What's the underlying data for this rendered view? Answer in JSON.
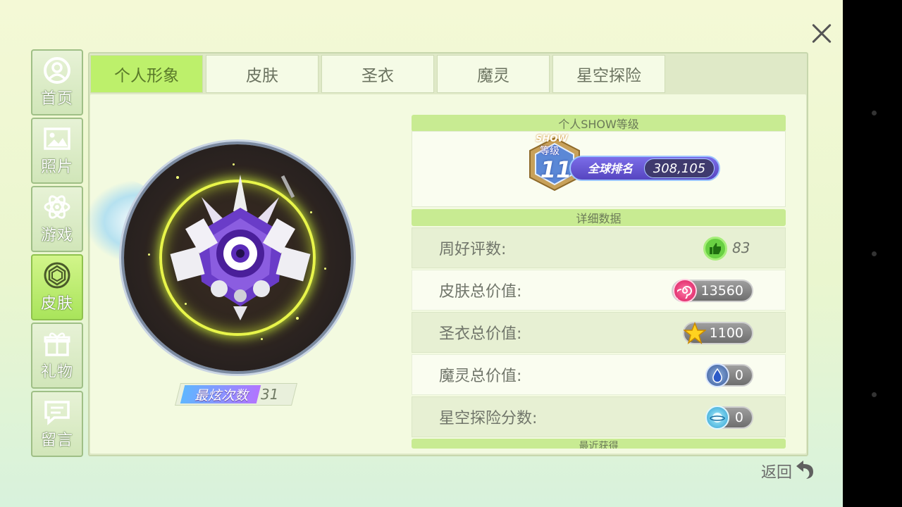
{
  "sidebar": {
    "items": [
      {
        "label": "首页",
        "icon": "user-circle-icon"
      },
      {
        "label": "照片",
        "icon": "picture-icon"
      },
      {
        "label": "游戏",
        "icon": "atom-icon"
      },
      {
        "label": "皮肤",
        "icon": "gem-circle-icon"
      },
      {
        "label": "礼物",
        "icon": "gift-icon"
      },
      {
        "label": "留言",
        "icon": "message-icon"
      }
    ],
    "active_index": 3
  },
  "tabs": [
    {
      "label": "个人形象"
    },
    {
      "label": "皮肤"
    },
    {
      "label": "圣衣"
    },
    {
      "label": "魔灵"
    },
    {
      "label": "星空探险"
    }
  ],
  "active_tab_index": 0,
  "avatar": {
    "combo_label": "最炫次数",
    "combo_value": "31"
  },
  "level_section": {
    "title": "个人SHOW等级",
    "badge_show": "SHOW",
    "badge_level_label": "等级",
    "level": "11",
    "rank_label": "全球排名",
    "rank_value": "308,105"
  },
  "detail_section": {
    "title": "详细数据",
    "rows": [
      {
        "label": "周好评数:",
        "value": "83",
        "icon": "thumbs-up-icon"
      },
      {
        "label": "皮肤总价值:",
        "value": "13560",
        "icon": "candy-swirl-icon"
      },
      {
        "label": "圣衣总价值:",
        "value": "1100",
        "icon": "star-icon"
      },
      {
        "label": "魔灵总价值:",
        "value": "0",
        "icon": "water-drop-icon"
      },
      {
        "label": "星空探险分数:",
        "value": "0",
        "icon": "planet-icon"
      }
    ],
    "next_partial": "最近获得"
  },
  "footer": {
    "return_label": "返回"
  },
  "colors": {
    "accent_green": "#bdf06b",
    "section_green": "#c8eb92",
    "pill_gray": "#8a8a8a"
  }
}
